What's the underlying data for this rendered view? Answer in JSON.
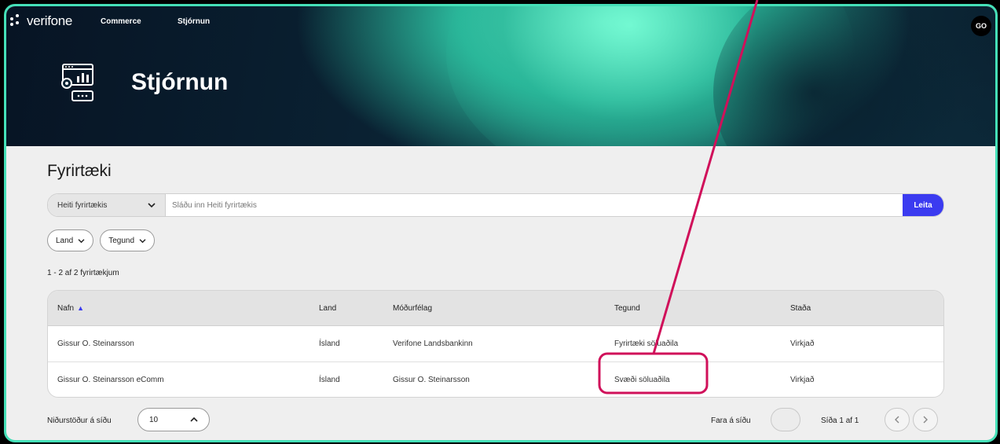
{
  "header": {
    "brand": "verifone",
    "nav": [
      "Commerce",
      "Stjórnun"
    ],
    "avatar_initials": "GO",
    "hero_title": "Stjórnun",
    "hero_icon": "dashboard-settings-icon"
  },
  "page": {
    "title": "Fyrirtæki"
  },
  "search": {
    "field_selected": "Heiti fyrirtækis",
    "placeholder": "Sláðu inn Heiti fyrirtækis",
    "button_label": "Leita"
  },
  "filters": [
    {
      "label": "Land"
    },
    {
      "label": "Tegund"
    }
  ],
  "results_count": "1 - 2 af 2 fyrirtækjum",
  "table": {
    "columns": [
      "Nafn",
      "Land",
      "Móðurfélag",
      "Tegund",
      "Staða"
    ],
    "rows": [
      {
        "name": "Gissur O. Steinarsson",
        "country": "Ísland",
        "parent": "Verifone Landsbankinn",
        "type": "Fyrirtæki söluaðila",
        "status": "Virkjað"
      },
      {
        "name": "Gissur O. Steinarsson eComm",
        "country": "Ísland",
        "parent": "Gissur O. Steinarsson",
        "type": "Svæði söluaðila",
        "status": "Virkjað"
      }
    ]
  },
  "pagination": {
    "per_page_label": "Niðurstöður á síðu",
    "per_page_value": "10",
    "goto_label": "Fara á síðu",
    "page_label": "Síða 1 af 1"
  },
  "colors": {
    "frame_border": "#45e0b8",
    "accent": "#3b3bf0",
    "annotation": "#d0105a"
  }
}
